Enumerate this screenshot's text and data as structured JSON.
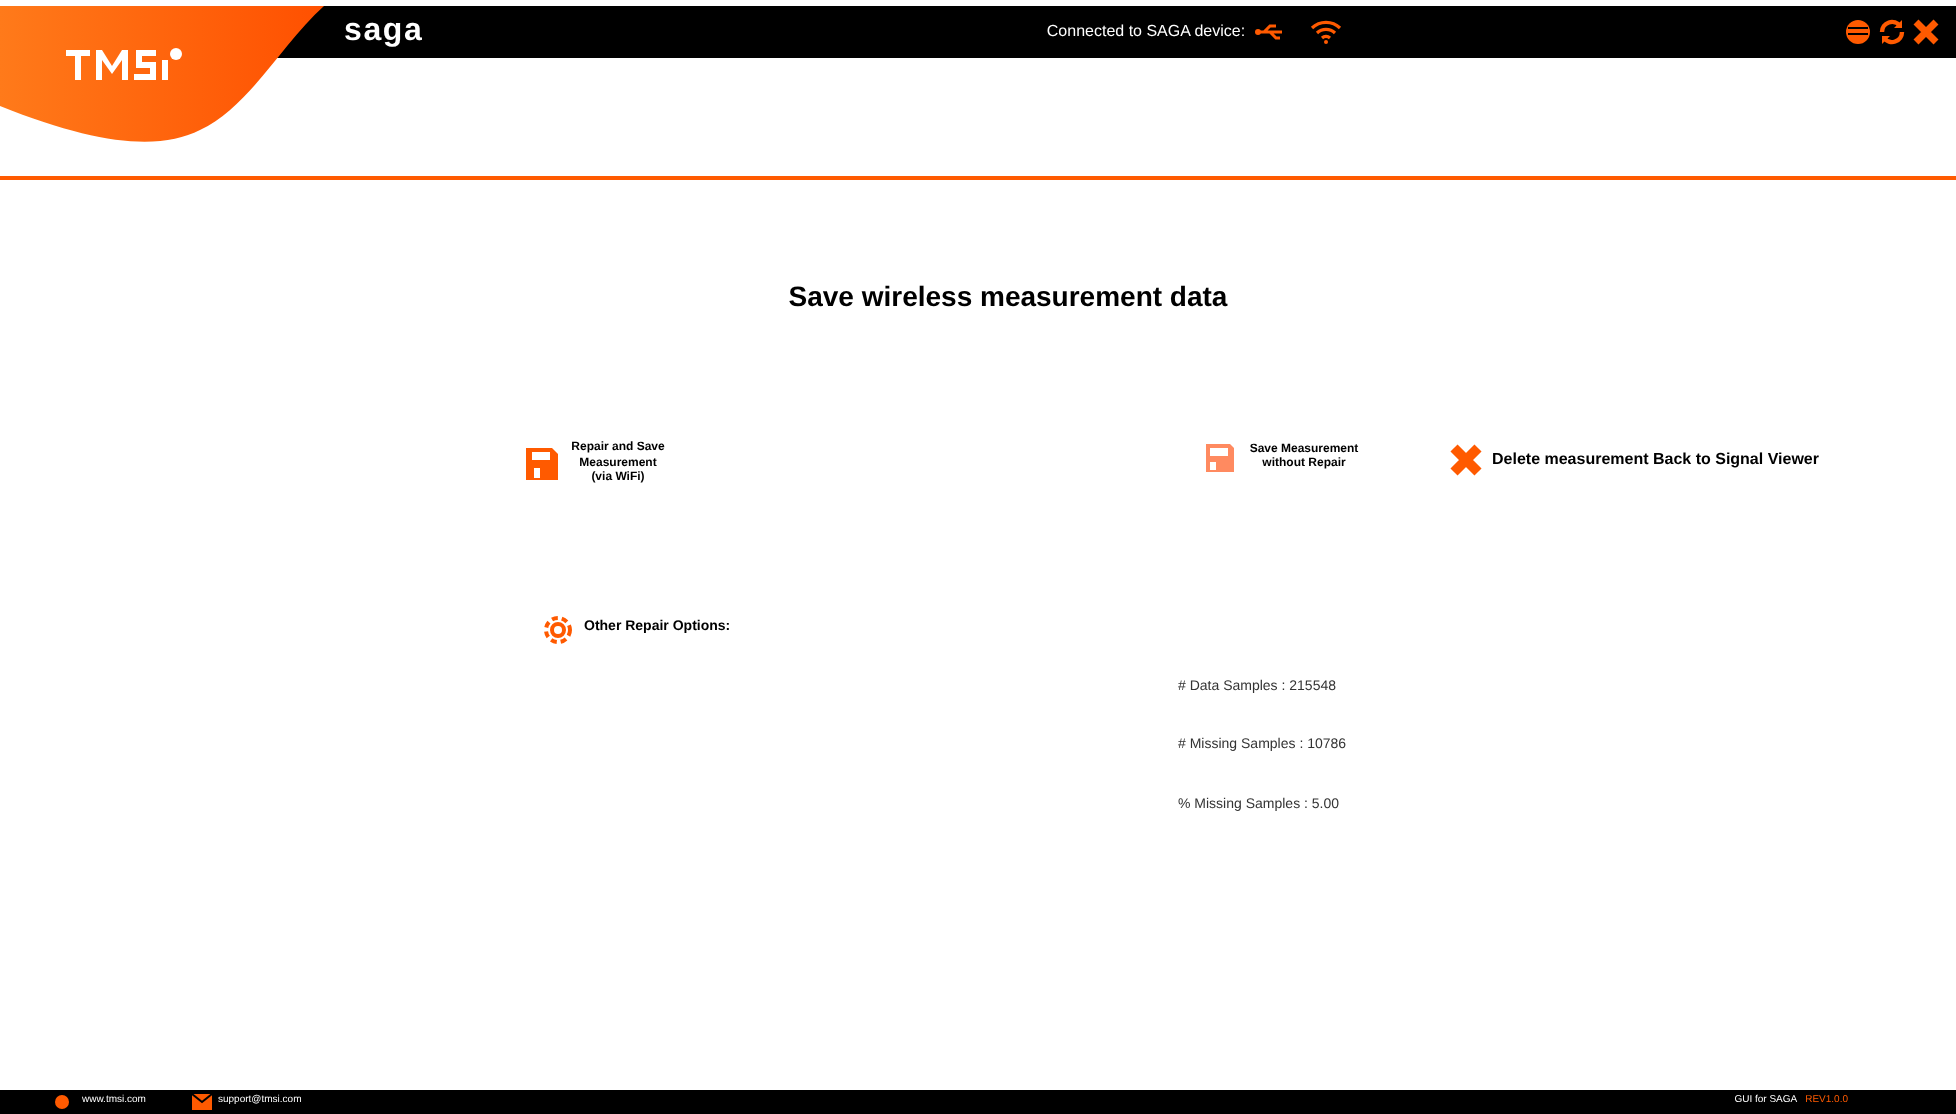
{
  "header": {
    "product": "saga",
    "connection": "Connected to SAGA device:"
  },
  "title": "Save wireless measurement data",
  "actions": [
    {
      "kind": "repair",
      "label": "Repair and Save Measurement (via WiFi)"
    },
    {
      "kind": "save",
      "label": "Save Measurement without Repair"
    },
    {
      "kind": "delete",
      "label": "Delete measurement Back to Signal Viewer"
    }
  ],
  "options": {
    "label": "Other Repair Options:"
  },
  "stats": [
    "# Data Samples : 215548",
    "# Missing Samples : 10786",
    "% Missing Samples : 5.00"
  ],
  "footer": {
    "website": "www.tmsi.com",
    "email": "support@tmsi.com",
    "app": "GUI for SAGA",
    "version": "REV1.0.0"
  }
}
